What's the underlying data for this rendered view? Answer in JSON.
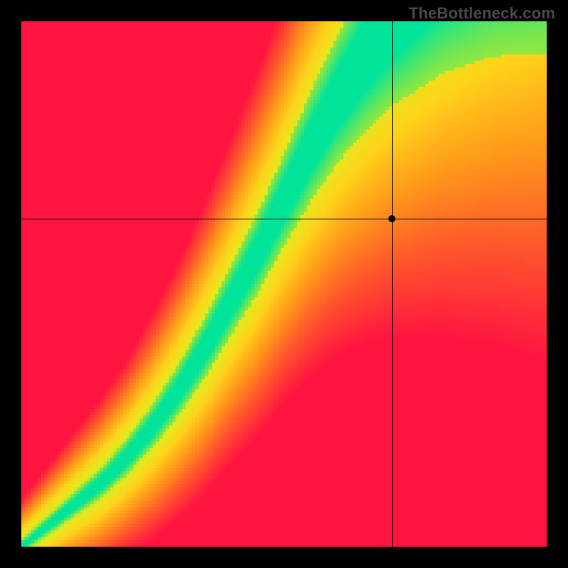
{
  "branding": {
    "watermark": "TheBottleneck.com"
  },
  "chart_data": {
    "type": "heatmap",
    "title": "",
    "xlabel": "",
    "ylabel": "",
    "x_range": [
      0,
      1
    ],
    "y_range": [
      0,
      1
    ],
    "crosshair": {
      "x": 0.705,
      "y": 0.625
    },
    "marker": {
      "x": 0.705,
      "y": 0.625
    },
    "optimal_curve_samples": {
      "description": "Approximate center of the green optimal band as y(x); heatmap intensity is distance from this curve",
      "x": [
        0.0,
        0.05,
        0.1,
        0.15,
        0.2,
        0.25,
        0.3,
        0.35,
        0.4,
        0.45,
        0.5,
        0.55,
        0.6,
        0.65,
        0.7,
        0.75,
        0.8,
        0.85,
        0.9,
        0.95,
        1.0
      ],
      "y": [
        0.0,
        0.04,
        0.08,
        0.12,
        0.17,
        0.23,
        0.3,
        0.38,
        0.47,
        0.56,
        0.66,
        0.76,
        0.85,
        0.93,
        1.0,
        1.06,
        1.12,
        1.17,
        1.22,
        1.26,
        1.3
      ]
    },
    "band_width_at_x": {
      "x": [
        0.0,
        0.1,
        0.2,
        0.3,
        0.4,
        0.5,
        0.6,
        0.7,
        0.8,
        0.9,
        1.0
      ],
      "width": [
        0.005,
        0.01,
        0.015,
        0.022,
        0.03,
        0.04,
        0.055,
        0.075,
        0.1,
        0.13,
        0.165
      ]
    },
    "color_stops": [
      {
        "t": 0.0,
        "color": "#00e49a"
      },
      {
        "t": 0.1,
        "color": "#7ee64a"
      },
      {
        "t": 0.2,
        "color": "#e3ea1e"
      },
      {
        "t": 0.35,
        "color": "#ffd21a"
      },
      {
        "t": 0.55,
        "color": "#ff9a1a"
      },
      {
        "t": 0.75,
        "color": "#ff5a2a"
      },
      {
        "t": 1.0,
        "color": "#ff1440"
      }
    ],
    "render_resolution": 160
  }
}
